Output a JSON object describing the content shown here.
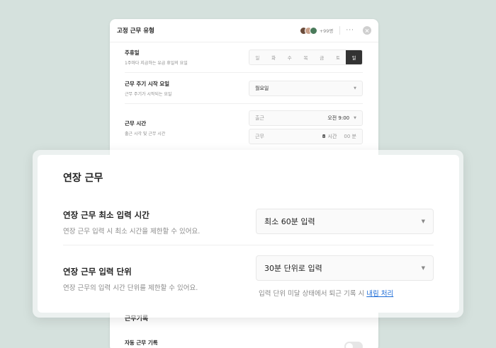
{
  "panel": {
    "title": "고정 근무 유형",
    "member_count": "+99명",
    "more": "···",
    "rows": {
      "holiday": {
        "title": "주휴일",
        "desc": "1주마다 지급하는 유급 휴일의 요일",
        "days": [
          "일",
          "화",
          "수",
          "목",
          "금",
          "토",
          "일"
        ],
        "active_index": 6
      },
      "cycle": {
        "title": "근무 주기 시작 요일",
        "desc": "근무 주기가 시작되는 요일",
        "value": "월요일"
      },
      "worktime": {
        "title": "근무 시간",
        "desc": "출근 시각 및 근무 시간",
        "start_label": "출근",
        "start_value": "오전 9:00",
        "duration_label": "근무",
        "hours": "8",
        "hours_unit": "시간",
        "minutes": "00 분"
      },
      "record_partial": "근무기록",
      "auto_record": "자동 근무 기록"
    }
  },
  "card": {
    "title": "연장 근무",
    "min_time": {
      "title": "연장 근무 최소 입력 시간",
      "desc": "연장 근무 입력 시 최소 시간을 제한할 수 있어요.",
      "value": "최소 60분 입력"
    },
    "unit": {
      "title": "연장 근무 입력 단위",
      "desc": "연장 근무의 입력 시간 단위를 제한할 수 있어요.",
      "value": "30분 단위로 입력"
    },
    "hint_prefix": "입력 단위 미달 상태에서 퇴근 기록 시",
    "hint_link": "내림 처리"
  },
  "colors": {
    "background": "#d5e1dd",
    "link": "#1a6ad6",
    "active_day": "#333333"
  }
}
